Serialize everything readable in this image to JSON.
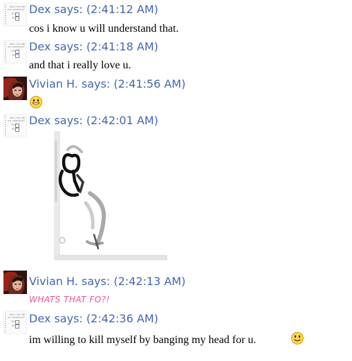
{
  "conversation": {
    "messages": [
      {
        "sender": "Dex says: (2:41:12 AM)",
        "text": "cos i know u will understand that."
      },
      {
        "sender": "Dex says: (2:41:18 AM)",
        "text": "and that i really love u."
      },
      {
        "sender": "Vivian H. says: (2:41:56 AM)",
        "emoticon": "smiley-icon"
      },
      {
        "sender": "Dex says: (2:42:01 AM)",
        "image": "stick-figure-banging-head-animation"
      },
      {
        "sender": "Vivian H. says: (2:42:13 AM)",
        "text": "WHATS THAT FO?!"
      },
      {
        "sender": "Dex says: (2:42:36 AM)",
        "text": "im willing to kill myself by banging my head for u.",
        "emoticon": "smiley-icon"
      }
    ]
  },
  "avatars": {
    "dex": {
      "icon": "dex-avatar-thumbnail",
      "lines": [
        "WILL YOU BE",
        "my valentine?",
        "YES",
        "NO"
      ]
    },
    "vivian": {
      "icon": "vivian-avatar-photo"
    }
  },
  "colors": {
    "sender_name": "#4266b0",
    "message_text": "#000000",
    "styled_message": "#e8519a",
    "emoticon_face": "#ffd84a"
  }
}
